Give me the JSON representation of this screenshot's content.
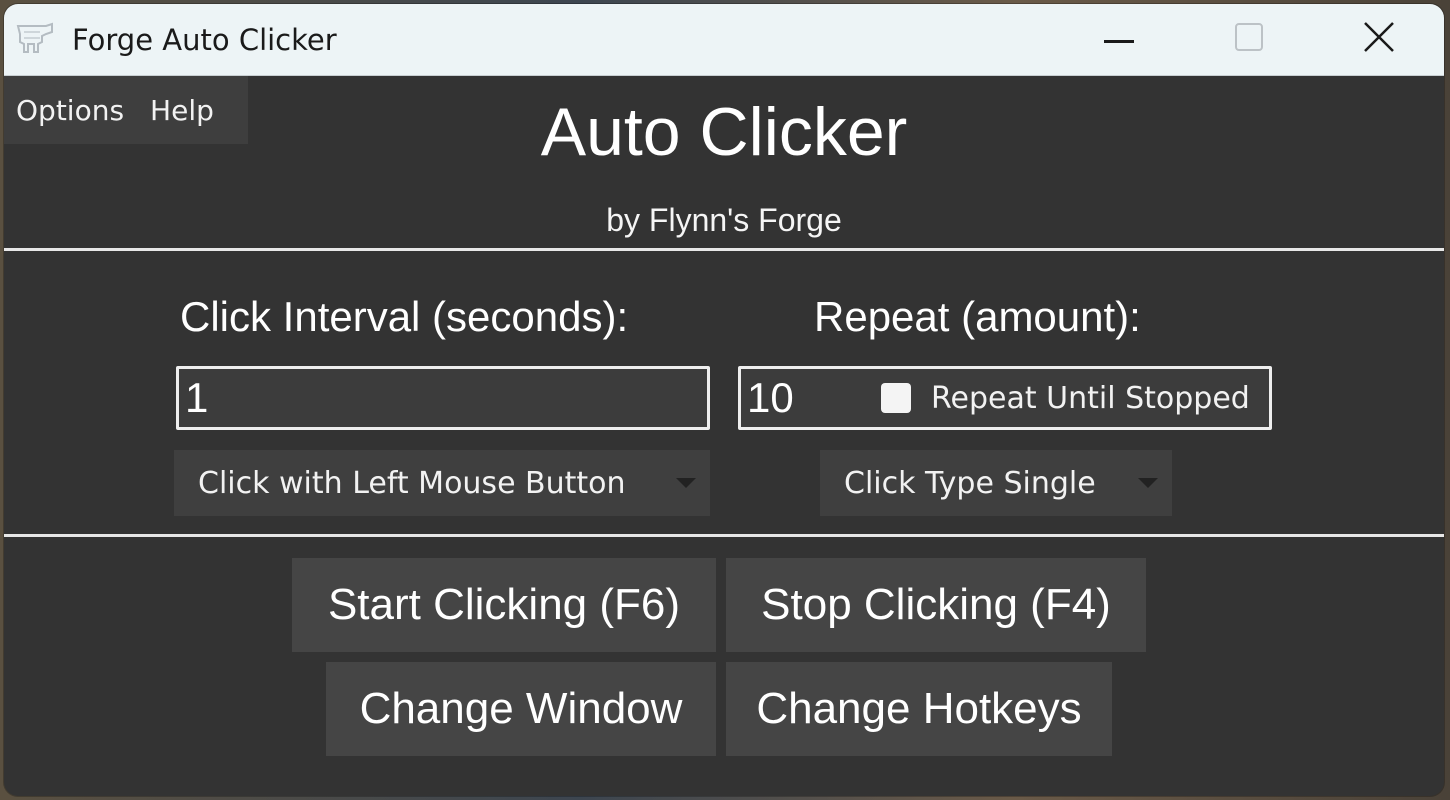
{
  "window": {
    "title": "Forge Auto Clicker",
    "app_icon": "forge-anvil-icon",
    "controls": {
      "minimize_icon": "minimize-icon",
      "maximize_icon": "maximize-icon",
      "close_icon": "close-icon"
    }
  },
  "menu": {
    "items": [
      {
        "label": "Options"
      },
      {
        "label": "Help"
      }
    ]
  },
  "header": {
    "title": "Auto Clicker",
    "subtitle": "by Flynn's Forge"
  },
  "interval": {
    "label": "Click Interval (seconds):",
    "value": "1"
  },
  "repeat": {
    "label": "Repeat (amount):",
    "value": "10",
    "until_stopped_label": "Repeat Until Stopped",
    "until_stopped_checked": false
  },
  "dropdowns": {
    "mouse_button": {
      "selected": "Click with Left Mouse Button"
    },
    "click_type": {
      "selected": "Click Type Single"
    }
  },
  "buttons": {
    "start": "Start Clicking (F6)",
    "stop": "Stop Clicking (F4)",
    "change_window": "Change Window",
    "change_hotkeys": "Change Hotkeys"
  },
  "colors": {
    "background": "#333333",
    "titlebar": "#edf4f6",
    "button": "#454545",
    "text": "#ffffff"
  }
}
